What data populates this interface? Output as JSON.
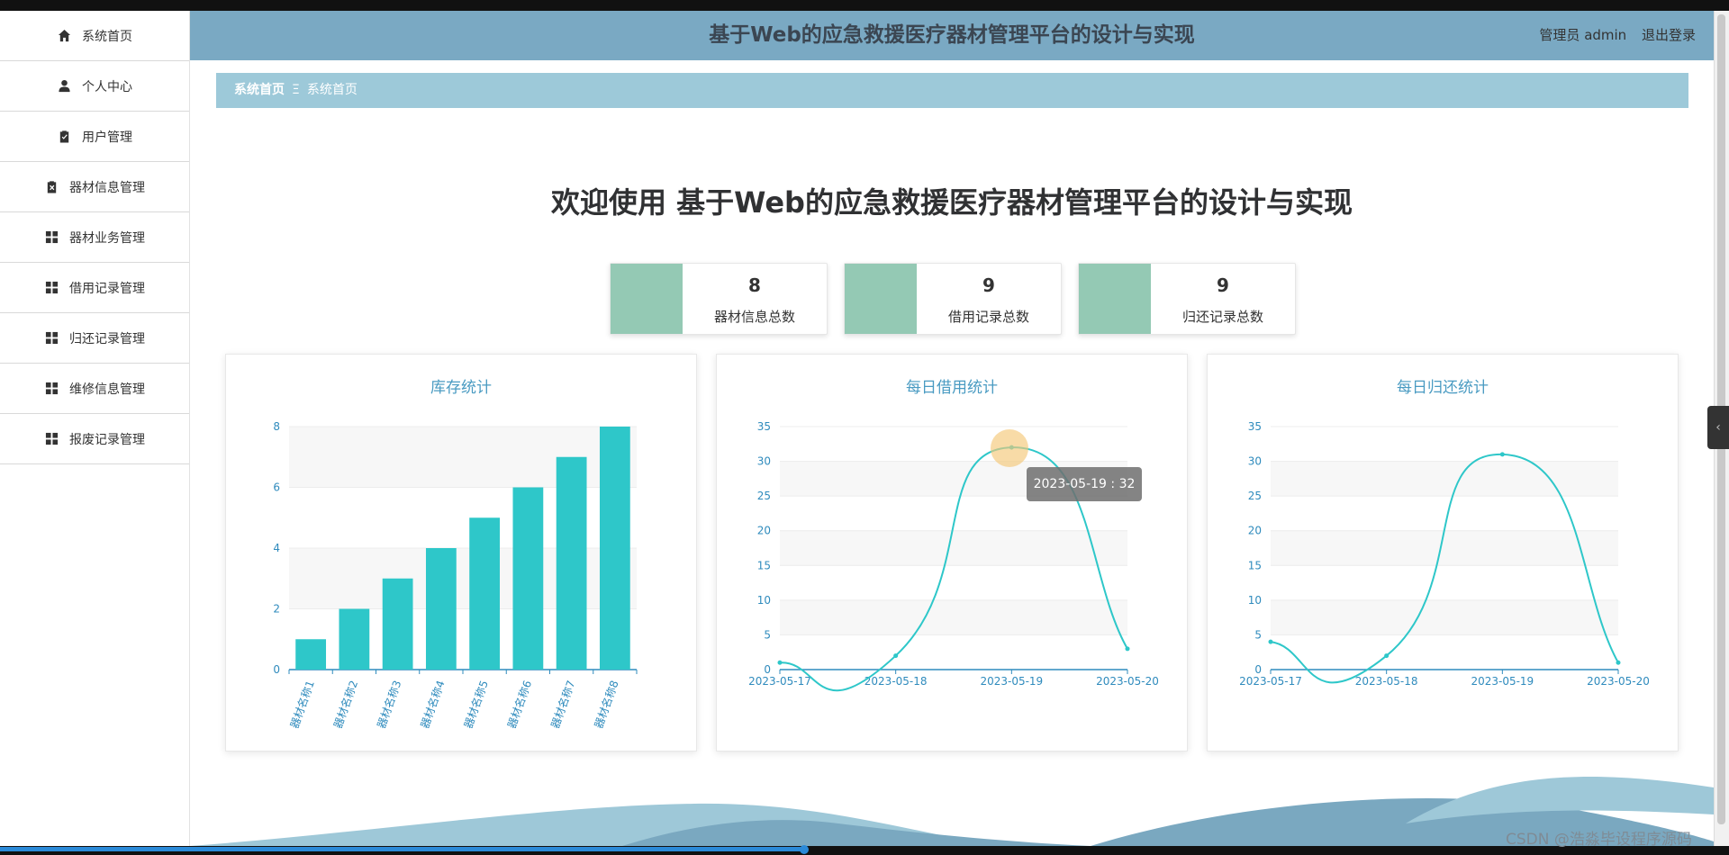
{
  "header": {
    "title": "基于Web的应急救援医疗器材管理平台的设计与实现",
    "user_label": "管理员 admin",
    "logout_label": "退出登录"
  },
  "sidebar": {
    "items": [
      {
        "label": "系统首页",
        "icon": "home-icon"
      },
      {
        "label": "个人中心",
        "icon": "user-icon"
      },
      {
        "label": "用户管理",
        "icon": "clipboard-check-icon"
      },
      {
        "label": "器材信息管理",
        "icon": "clipboard-x-icon"
      },
      {
        "label": "器材业务管理",
        "icon": "grid-icon"
      },
      {
        "label": "借用记录管理",
        "icon": "grid-icon"
      },
      {
        "label": "归还记录管理",
        "icon": "grid-icon"
      },
      {
        "label": "维修信息管理",
        "icon": "grid-icon"
      },
      {
        "label": "报废记录管理",
        "icon": "grid-icon"
      }
    ]
  },
  "breadcrumb": {
    "home": "系统首页",
    "separator": "Ξ",
    "current": "系统首页"
  },
  "welcome": "欢迎使用 基于Web的应急救援医疗器材管理平台的设计与实现",
  "stats": [
    {
      "value": "8",
      "label": "器材信息总数"
    },
    {
      "value": "9",
      "label": "借用记录总数"
    },
    {
      "value": "9",
      "label": "归还记录总数"
    }
  ],
  "colors": {
    "accent": "#2ec7c9",
    "header": "#7aa9c3",
    "breadcrumb": "#9dc9d9",
    "stat_block": "#94c9b4",
    "title": "#4a9bc2"
  },
  "tooltip": "2023-05-19 : 32",
  "watermark": "CSDN @浩淼毕设程序源码",
  "chart_data": [
    {
      "type": "bar",
      "title": "库存统计",
      "categories": [
        "器材名称1",
        "器材名称2",
        "器材名称3",
        "器材名称4",
        "器材名称5",
        "器材名称6",
        "器材名称7",
        "器材名称8"
      ],
      "values": [
        1,
        2,
        3,
        4,
        5,
        6,
        7,
        8
      ],
      "ylim": [
        0,
        8
      ],
      "yticks": [
        0,
        2,
        4,
        6,
        8
      ],
      "grid": true
    },
    {
      "type": "line",
      "title": "每日借用统计",
      "x": [
        "2023-05-17",
        "2023-05-18",
        "2023-05-19",
        "2023-05-20"
      ],
      "values": [
        1,
        2,
        32,
        3
      ],
      "ylim": [
        0,
        35
      ],
      "yticks": [
        0,
        5,
        10,
        15,
        20,
        25,
        30,
        35
      ],
      "smooth": true,
      "grid": true
    },
    {
      "type": "line",
      "title": "每日归还统计",
      "x": [
        "2023-05-17",
        "2023-05-18",
        "2023-05-19",
        "2023-05-20"
      ],
      "values": [
        4,
        2,
        31,
        1
      ],
      "ylim": [
        0,
        35
      ],
      "yticks": [
        0,
        5,
        10,
        15,
        20,
        25,
        30,
        35
      ],
      "smooth": true,
      "grid": true
    }
  ]
}
